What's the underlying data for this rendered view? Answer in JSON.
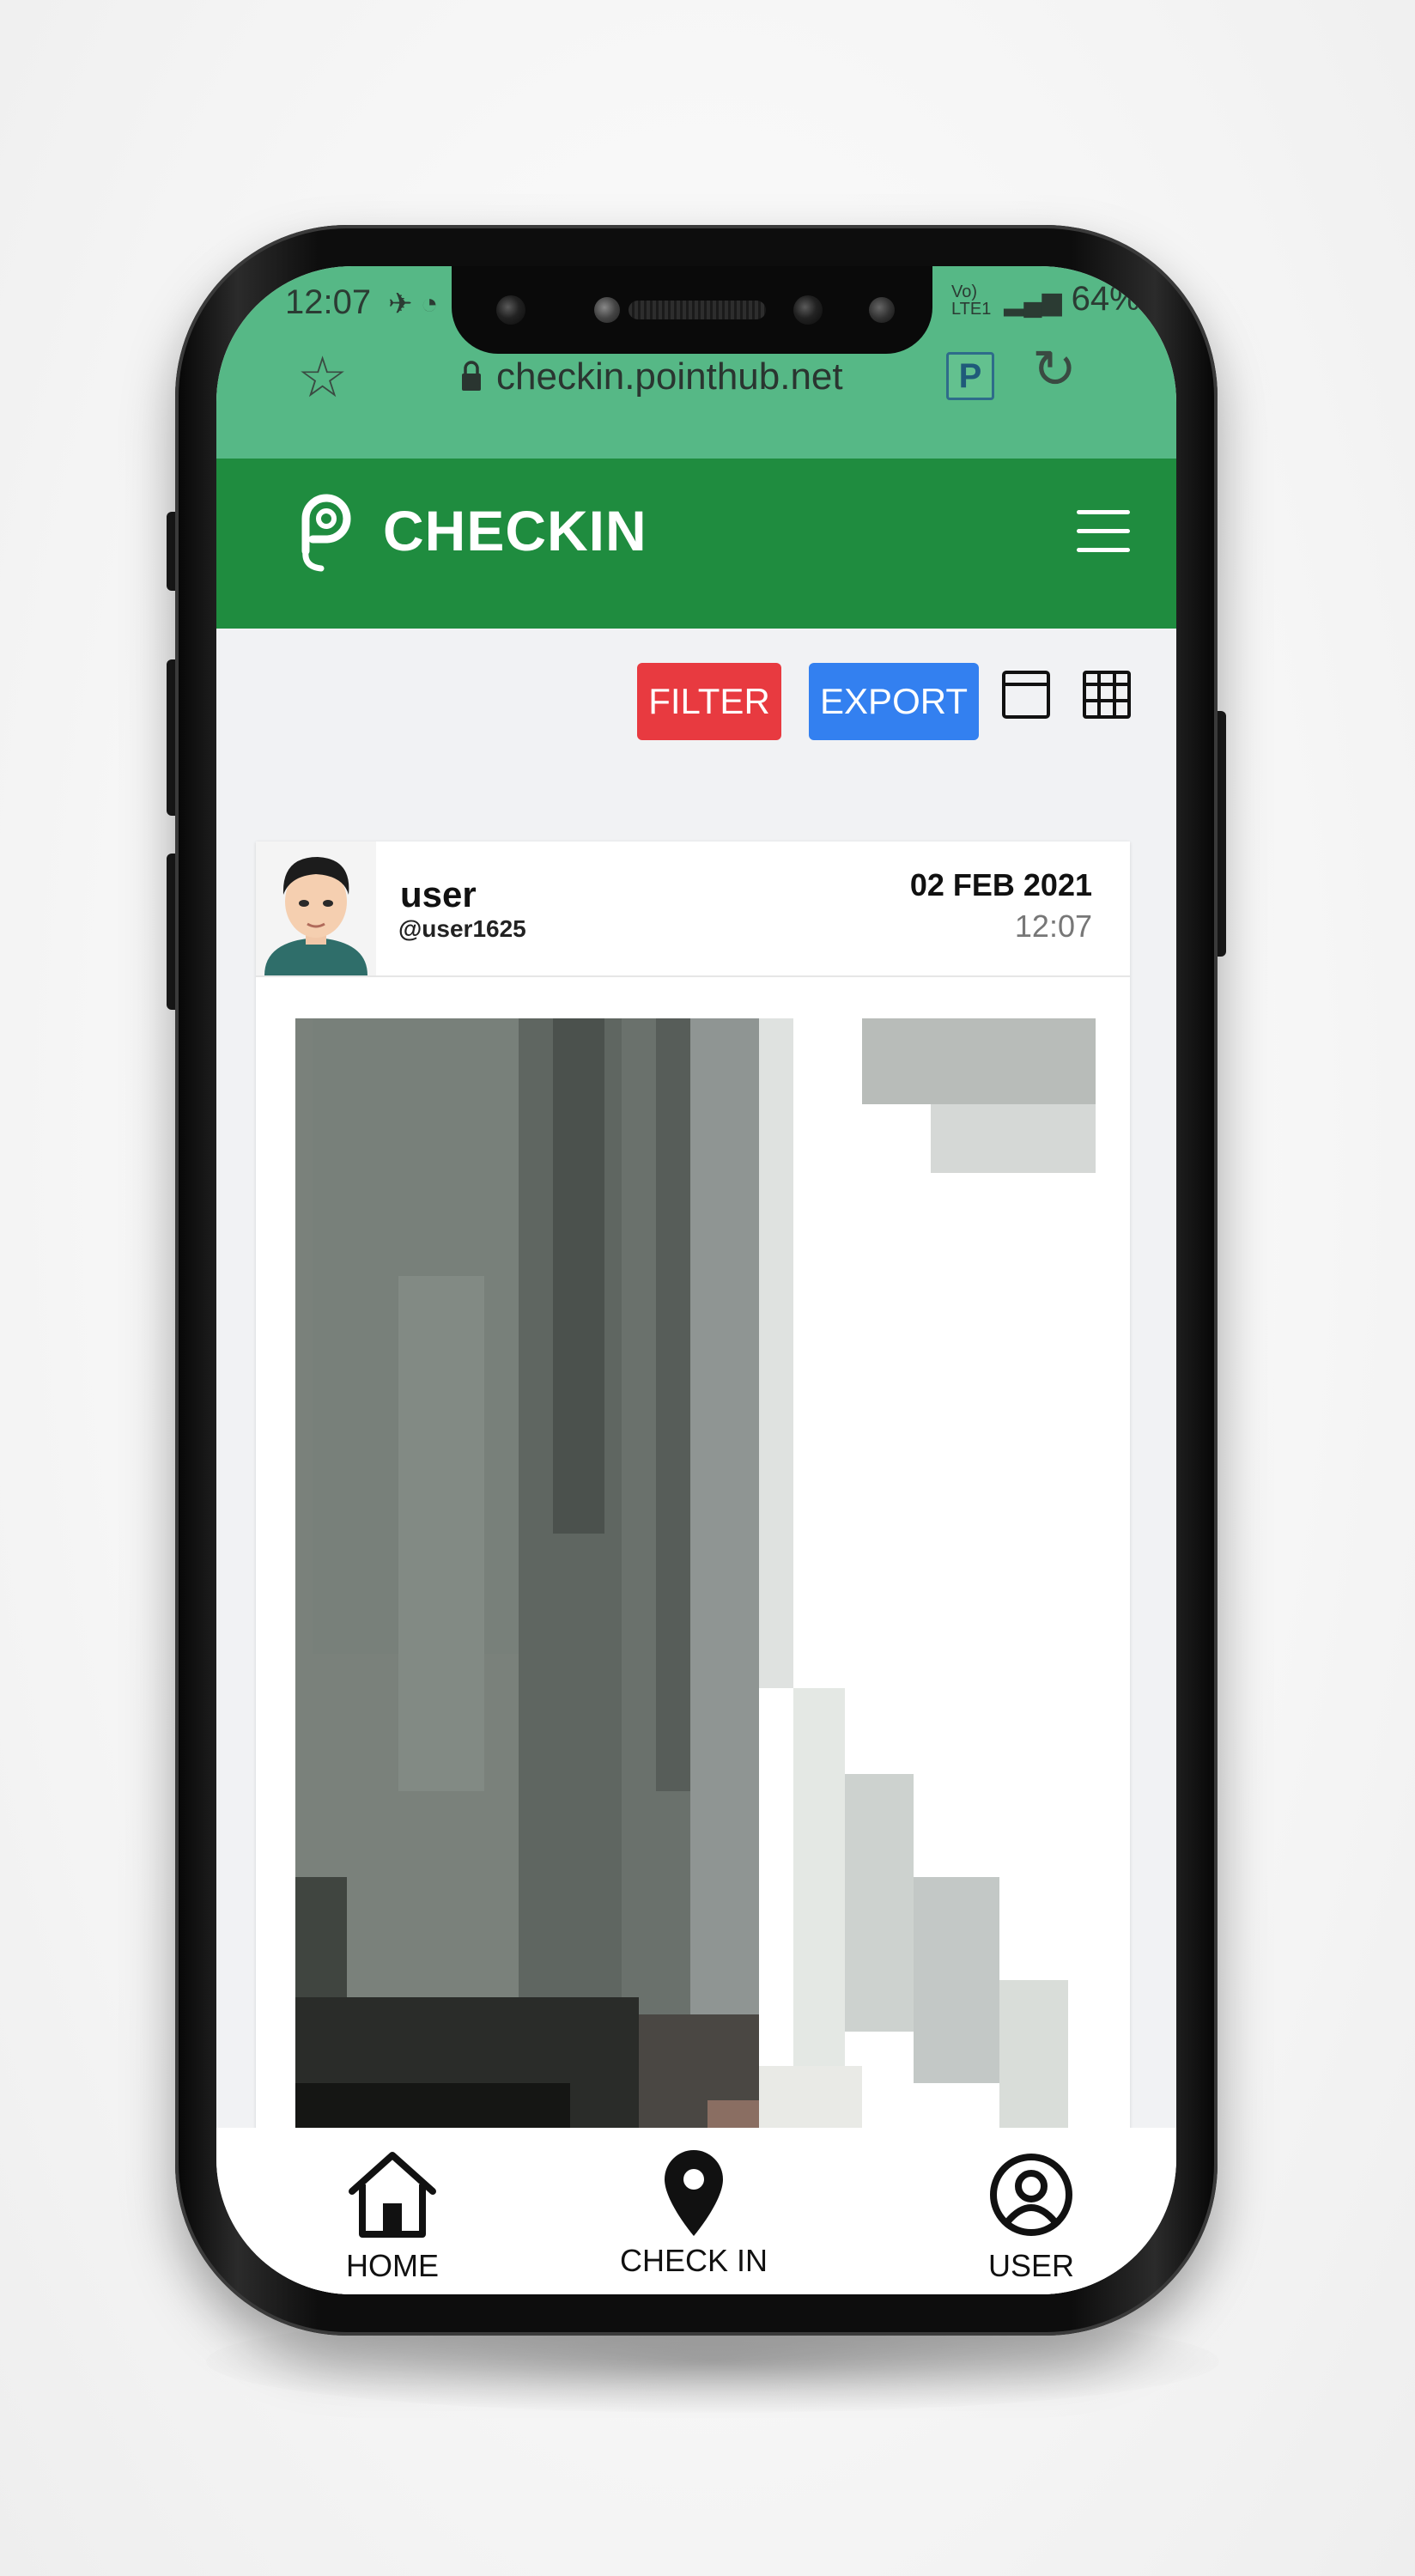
{
  "status_bar": {
    "time": "12:07",
    "battery": "64%",
    "network": "Vo) LTE1"
  },
  "browser": {
    "url": "checkin.pointhub.net",
    "icons": [
      "star-icon",
      "lock-icon",
      "extension-icon",
      "reload-icon"
    ]
  },
  "app_bar": {
    "brand": "CHECKIN",
    "logo_letter": "P",
    "menu_icon": "hamburger-icon"
  },
  "toolbar": {
    "filter_label": "FILTER",
    "export_label": "EXPORT",
    "view_icons": [
      "list-view-icon",
      "grid-view-icon"
    ]
  },
  "colors": {
    "browser_bar": "#56b886",
    "app_bar": "#1f8c3f",
    "filter": "#e83a40",
    "export": "#3380f0"
  },
  "checkin_card": {
    "username": "user",
    "handle": "@user1625",
    "date": "02 FEB 2021",
    "time": "12:07"
  },
  "bottom_nav": {
    "items": [
      {
        "label": "HOME",
        "icon": "home-icon"
      },
      {
        "label": "CHECK IN",
        "icon": "location-pin-icon"
      },
      {
        "label": "USER",
        "icon": "user-circle-icon"
      }
    ]
  }
}
